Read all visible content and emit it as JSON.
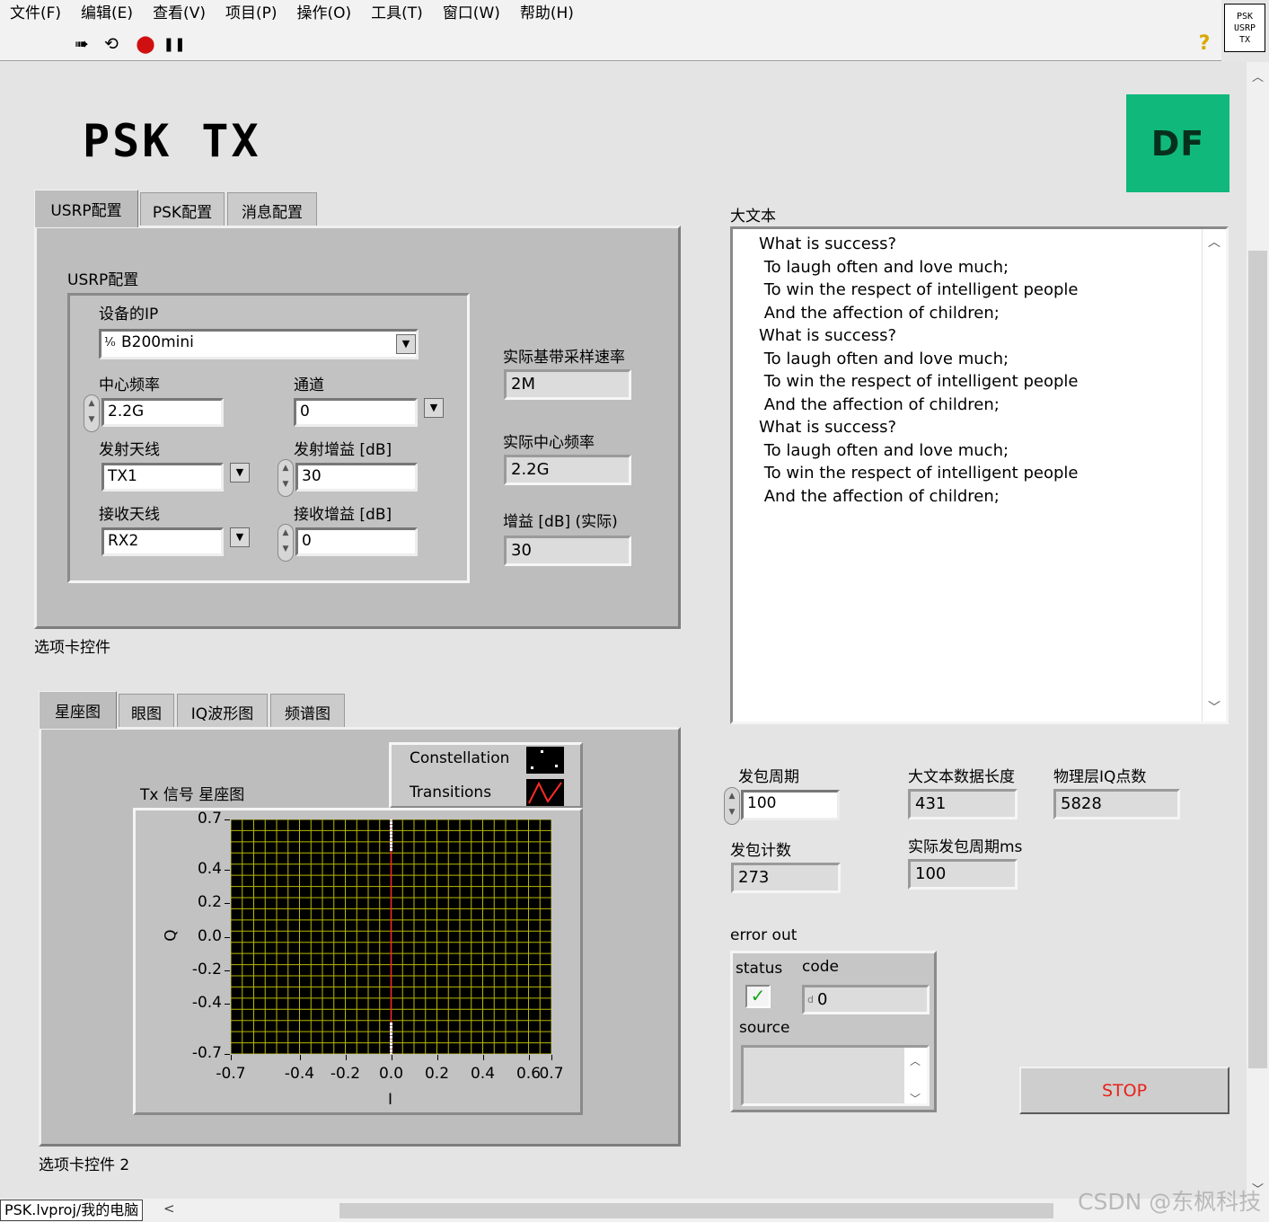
{
  "menu": [
    "文件(F)",
    "编辑(E)",
    "查看(V)",
    "项目(P)",
    "操作(O)",
    "工具(T)",
    "窗口(W)",
    "帮助(H)"
  ],
  "toolbar": {
    "run": "➠",
    "run_cont": "⟲",
    "abort": "⬤",
    "pause": "❚❚",
    "help": "?"
  },
  "vi_icon": {
    "line1": "PSK",
    "line2": "USRP",
    "line3": "TX"
  },
  "page_title": "PSK  TX",
  "logo_text": "DF",
  "tabs1": {
    "items": [
      "USRP配置",
      "PSK配置",
      "消息配置"
    ],
    "caption": "选项卡控件",
    "cluster_label": "USRP配置",
    "device_ip_label": "设备的IP",
    "device_ip_value": "B200mini",
    "center_freq_label": "中心频率",
    "center_freq_value": "2.2G",
    "channel_label": "通道",
    "channel_value": "0",
    "tx_antenna_label": "发射天线",
    "tx_antenna_value": "TX1",
    "tx_gain_label": "发射增益 [dB]",
    "tx_gain_value": "30",
    "rx_antenna_label": "接收天线",
    "rx_antenna_value": "RX2",
    "rx_gain_label": "接收增益 [dB]",
    "rx_gain_value": "0",
    "actual_rate_label": "实际基带采样速率",
    "actual_rate_value": "2M",
    "actual_freq_label": "实际中心频率",
    "actual_freq_value": "2.2G",
    "actual_gain_label": "增益 [dB] (实际)",
    "actual_gain_value": "30"
  },
  "tabs2": {
    "items": [
      "星座图",
      "眼图",
      "IQ波形图",
      "频谱图"
    ],
    "caption": "选项卡控件 2",
    "legend": [
      "Constellation",
      "Transitions"
    ]
  },
  "big_text": {
    "label": "大文本",
    "lines": [
      "What is success?",
      " To laugh often and love much;",
      " To win the respect of intelligent people",
      " And the affection of children;",
      "What is success?",
      " To laugh often and love much;",
      " To win the respect of intelligent people",
      " And the affection of children;",
      "What is success?",
      " To laugh often and love much;",
      " To win the respect of intelligent people",
      " And the affection of children;"
    ]
  },
  "stats": {
    "packet_period_label": "发包周期",
    "packet_period_value": "100",
    "text_len_label": "大文本数据长度",
    "text_len_value": "431",
    "iq_points_label": "物理层IQ点数",
    "iq_points_value": "5828",
    "packet_count_label": "发包计数",
    "packet_count_value": "273",
    "actual_period_label": "实际发包周期ms",
    "actual_period_value": "100"
  },
  "error_out": {
    "label": "error out",
    "status_label": "status",
    "code_label": "code",
    "code_value": "0",
    "code_prefix": "d",
    "source_label": "source",
    "status_ok": true
  },
  "stop_label": "STOP",
  "status_bar": {
    "path": "PSK.lvproj/我的电脑"
  },
  "watermark": "CSDN @东枫科技",
  "colors": {
    "accent_green": "#10b97b",
    "stop_red": "#e8221a",
    "plot_grid": "#b8b800",
    "trace_red": "#ff2a2a"
  },
  "chart_data": {
    "type": "scatter",
    "title": "Tx 信号 星座图",
    "xlabel": "I",
    "ylabel": "Q",
    "xlim": [
      -0.7,
      0.7
    ],
    "ylim": [
      -0.7,
      0.7
    ],
    "x_ticks": [
      "-0.7",
      "-0.4",
      "-0.2",
      "0.0",
      "0.2",
      "0.4",
      "0.6",
      "0.7"
    ],
    "x_tick_values": [
      -0.7,
      -0.4,
      -0.2,
      0.0,
      0.2,
      0.4,
      0.6,
      0.7
    ],
    "y_ticks": [
      "0.7",
      "0.4",
      "0.2",
      "0.0",
      "-0.2",
      "-0.4",
      "-0.7"
    ],
    "y_tick_values": [
      0.7,
      0.4,
      0.2,
      0.0,
      -0.2,
      -0.4,
      -0.7
    ],
    "grid": true,
    "series": [
      {
        "name": "Constellation",
        "x": [
          0,
          0,
          0,
          0,
          0,
          0,
          0,
          0,
          0,
          0,
          0,
          0,
          0,
          0,
          0,
          0,
          0,
          0,
          0,
          0
        ],
        "y": [
          0.7,
          0.68,
          0.66,
          0.64,
          0.62,
          0.6,
          0.58,
          0.56,
          0.54,
          0.52,
          -0.52,
          -0.54,
          -0.56,
          -0.58,
          -0.6,
          -0.62,
          -0.64,
          -0.66,
          -0.68,
          -0.7
        ]
      },
      {
        "name": "Transitions",
        "x": [
          0,
          0
        ],
        "y": [
          0.7,
          -0.7
        ]
      }
    ]
  }
}
